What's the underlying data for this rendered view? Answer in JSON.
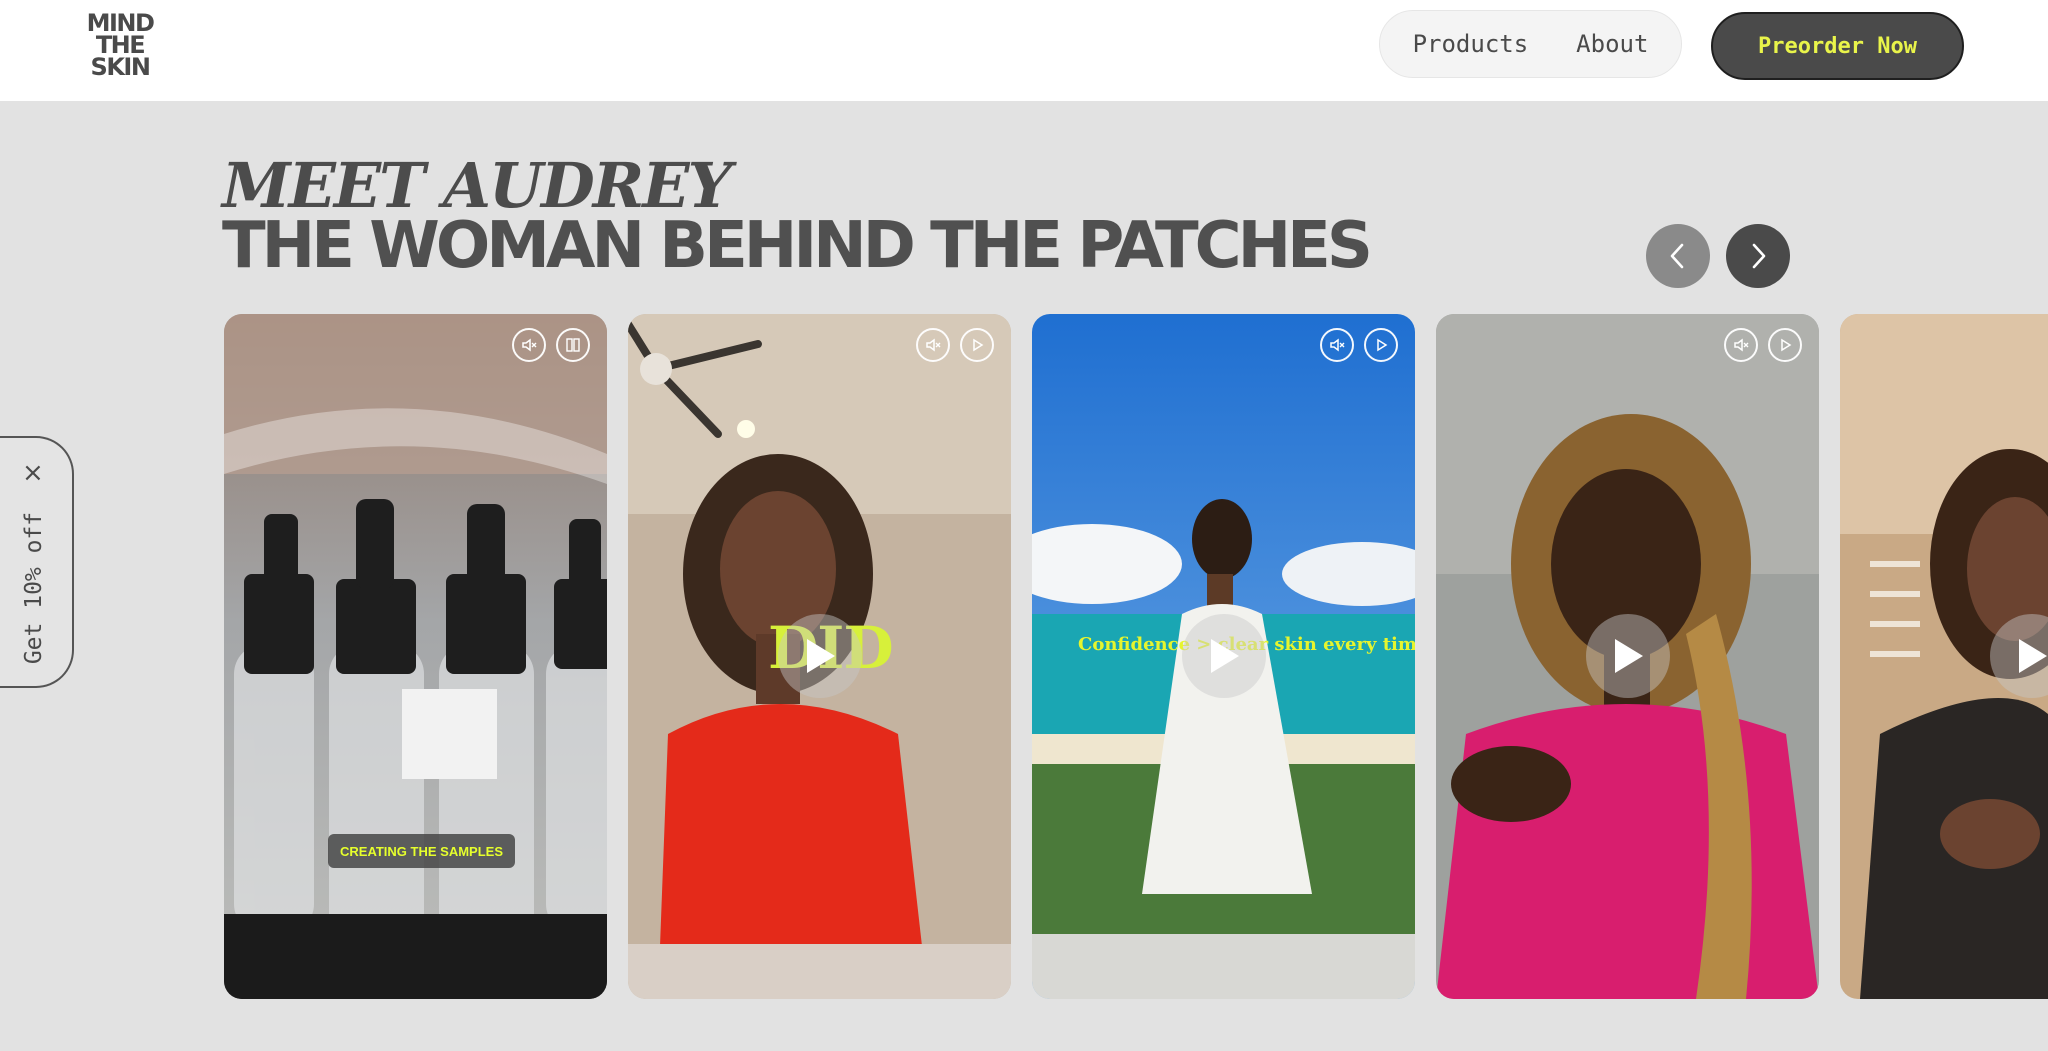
{
  "header": {
    "logo_lines": [
      "MIND",
      "THE",
      "SKIN"
    ],
    "nav": [
      {
        "label": "Products"
      },
      {
        "label": "About"
      }
    ],
    "preorder_label": "Preorder Now"
  },
  "section": {
    "eyebrow": "MEET AUDREY",
    "headline": "THE WOMAN BEHIND THE PATCHES"
  },
  "discount": {
    "label": "Get 10% off",
    "close_glyph": "×"
  },
  "cards": [
    {
      "caption": "CREATING THE SAMPLES",
      "controls": [
        "mute-icon",
        "fullscreen-icon"
      ]
    },
    {
      "overlay_text": "DID",
      "controls": [
        "mute-icon",
        "play-icon"
      ]
    },
    {
      "overlay_text": "Confidence > clear skin every time",
      "controls": [
        "mute-icon",
        "play-icon"
      ]
    },
    {
      "controls": [
        "mute-icon",
        "play-icon"
      ]
    },
    {
      "controls": []
    }
  ],
  "colors": {
    "accent": "#e9f44a",
    "dark": "#4a4a4a",
    "background": "#e2e2e2"
  }
}
